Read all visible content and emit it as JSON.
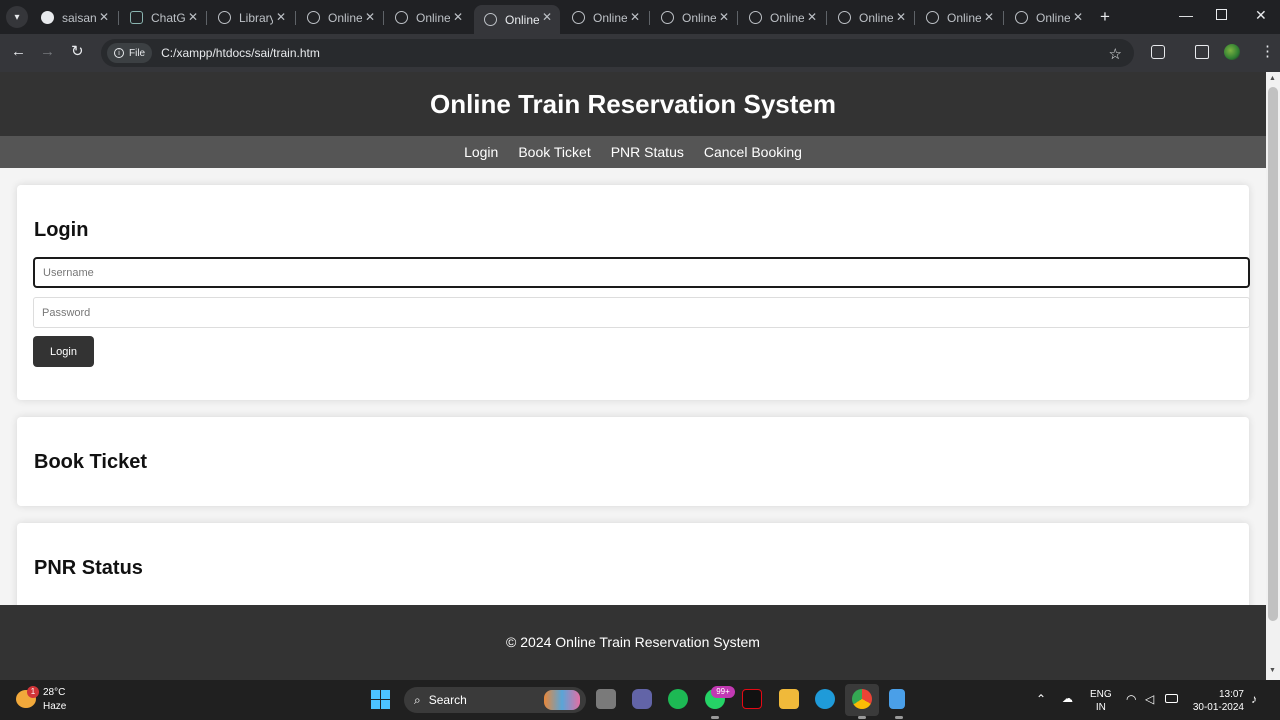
{
  "browser": {
    "tabs": [
      {
        "title": "saisant",
        "icon": "github-icon"
      },
      {
        "title": "ChatGPT",
        "icon": "chatgpt-icon"
      },
      {
        "title": "Library",
        "icon": "globe-icon"
      },
      {
        "title": "Online",
        "icon": "globe-icon"
      },
      {
        "title": "Online",
        "icon": "globe-icon"
      },
      {
        "title": "Online",
        "icon": "globe-icon",
        "active": true
      },
      {
        "title": "Online",
        "icon": "globe-icon"
      },
      {
        "title": "Online",
        "icon": "globe-icon"
      },
      {
        "title": "Online",
        "icon": "globe-icon"
      },
      {
        "title": "Online",
        "icon": "globe-icon"
      },
      {
        "title": "Online",
        "icon": "globe-icon"
      },
      {
        "title": "Online",
        "icon": "globe-icon"
      }
    ],
    "address": {
      "scheme_label": "File",
      "url": "C:/xampp/htdocs/sai/train.htm"
    }
  },
  "page": {
    "header_title": "Online Train Reservation System",
    "nav": [
      "Login",
      "Book Ticket",
      "PNR Status",
      "Cancel Booking"
    ],
    "login": {
      "heading": "Login",
      "username_placeholder": "Username",
      "password_placeholder": "Password",
      "button_label": "Login"
    },
    "book_ticket": {
      "heading": "Book Ticket"
    },
    "pnr_status": {
      "heading": "PNR Status"
    },
    "footer": "© 2024 Online Train Reservation System"
  },
  "taskbar": {
    "weather": {
      "temp": "28°C",
      "desc": "Haze",
      "badge": "1"
    },
    "search_label": "Search",
    "whatsapp_badge": "99+",
    "lang": {
      "line1": "ENG",
      "line2": "IN"
    },
    "clock": {
      "time": "13:07",
      "date": "30-01-2024"
    }
  },
  "colors": {
    "header_bg": "#333333",
    "nav_bg": "#555555",
    "page_bg": "#f4f4f4",
    "button_bg": "#333333"
  }
}
